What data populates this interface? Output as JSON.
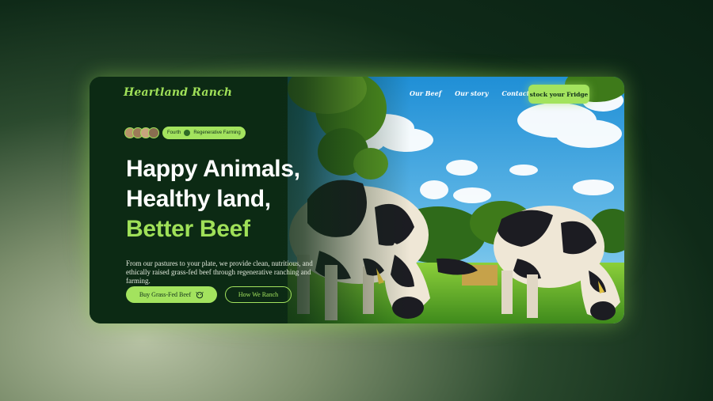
{
  "brand": {
    "name": "Heartland Ranch"
  },
  "nav": {
    "items": [
      "Our Beef",
      "Our story",
      "Contact"
    ],
    "cta": "stock your Fridge"
  },
  "badge": {
    "left_text": "Fourth",
    "right_text": "Regenerative Farming",
    "avatar_colors": [
      "#b7936a",
      "#9d7a58",
      "#c9a47d",
      "#8a6d50"
    ]
  },
  "hero": {
    "line1": "Happy Animals,",
    "line2": "Healthy land,",
    "line3": "Better Beef",
    "description": "From our pastures to your plate, we provide clean, nutritious, and ethically raised grass-fed beef through regenerative ranching and farming."
  },
  "buttons": {
    "primary": "Buy Grass-Fed Beef",
    "secondary": "How We Ranch"
  },
  "colors": {
    "accent": "#a3e35e",
    "dark_green": "#0c2a14",
    "text_white": "#ffffff"
  },
  "icons": {
    "primary_button": "cow-face-icon",
    "badge_leaf": "leaf-icon"
  }
}
